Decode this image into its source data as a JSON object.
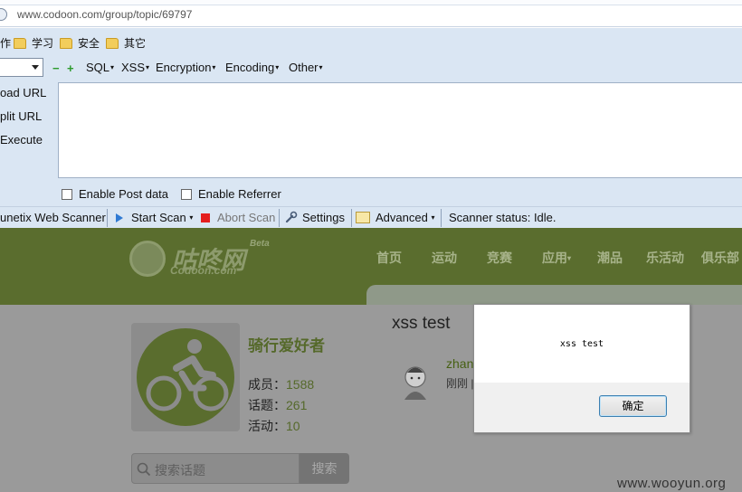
{
  "browser": {
    "url": "www.codoon.com/group/topic/69797",
    "bookmarks": [
      "作",
      "学习",
      "安全",
      "其它"
    ]
  },
  "hackbar": {
    "menus": [
      "SQL",
      "XSS",
      "Encryption",
      "Encoding",
      "Other"
    ],
    "side_actions": [
      "oad URL",
      "plit URL",
      "Execute"
    ],
    "checkboxes": [
      "Enable Post data",
      "Enable Referrer"
    ]
  },
  "scanner": {
    "name": "unetix Web Scanner",
    "start": "Start Scan",
    "abort": "Abort Scan",
    "settings": "Settings",
    "advanced": "Advanced",
    "status": "Scanner status: Idle."
  },
  "site": {
    "logo_cn": "咕咚网",
    "logo_en": "Codoon.com",
    "beta": "Beta",
    "nav": [
      "首页",
      "运动",
      "竞赛",
      "应用",
      "潮品",
      "乐活动",
      "俱乐部"
    ]
  },
  "group": {
    "name": "骑行爱好者",
    "members_label": "成员：",
    "members": "1588",
    "topics_label": "话题：",
    "topics": "261",
    "events_label": "活动：",
    "events": "10",
    "search_placeholder": "搜索话题",
    "search_button": "搜索"
  },
  "topic": {
    "title": "xss test",
    "author": "zhan",
    "time": "刚刚 |"
  },
  "dialog": {
    "message": "xss test",
    "ok": "确定"
  },
  "watermark": "www.wooyun.org"
}
